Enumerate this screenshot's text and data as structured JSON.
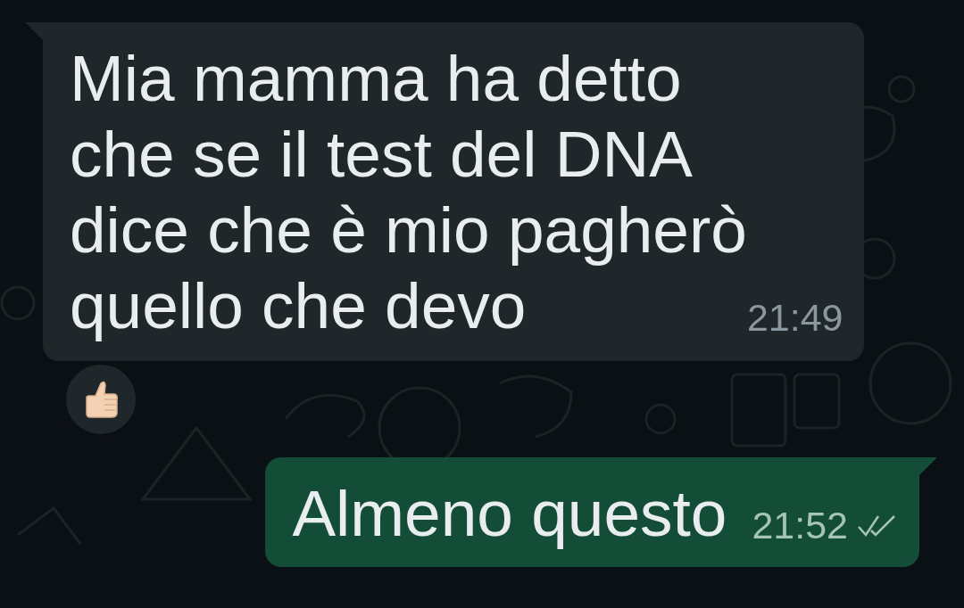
{
  "messages": [
    {
      "kind": "incoming",
      "text": "Mia mamma ha detto\nche se il test del DNA\ndice che è mio pagherò\nquello che devo",
      "time": "21:49",
      "reaction": true
    },
    {
      "kind": "outgoing",
      "text": "Almeno questo",
      "time": "21:52",
      "read": false
    }
  ]
}
